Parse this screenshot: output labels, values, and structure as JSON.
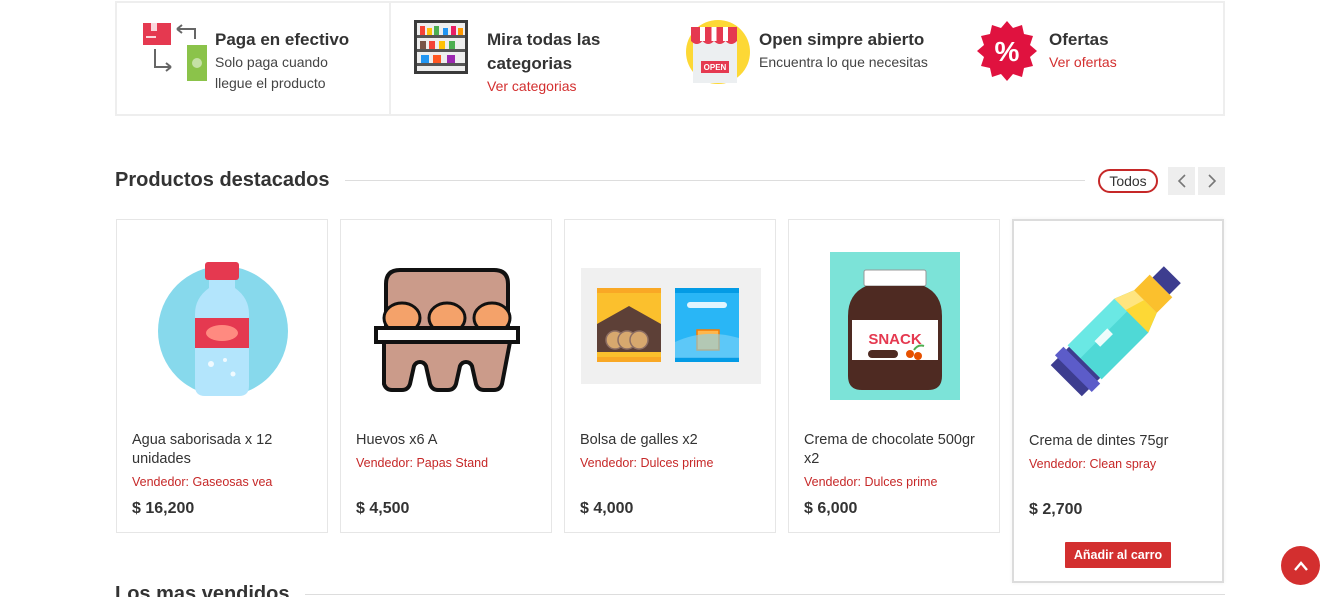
{
  "features": [
    {
      "title": "Paga en efectivo",
      "sub_lines": [
        "Solo paga cuando",
        "llegue el producto"
      ],
      "icon": "cash-exchange-icon"
    },
    {
      "title_lines": [
        "Mira todas las",
        "categorias"
      ],
      "link": "Ver categorias",
      "icon": "store-shelves-icon"
    },
    {
      "title": "Open simpre abierto",
      "sub": "Encuentra lo que necesitas",
      "icon": "open-store-icon"
    },
    {
      "title": "Ofertas",
      "link": "Ver ofertas",
      "icon": "discount-badge-icon"
    }
  ],
  "featured": {
    "title": "Productos destacados",
    "all_label": "Todos"
  },
  "products": [
    {
      "name": "Agua saborisada x 12 unidades",
      "vendor": "Vendedor: Gaseosas vea",
      "price": "$ 16,200",
      "icon": "water-bottle-icon"
    },
    {
      "name": "Huevos x6 A",
      "vendor": "Vendedor: Papas Stand",
      "price": "$ 4,500",
      "icon": "egg-carton-icon"
    },
    {
      "name": "Bolsa de galles x2",
      "vendor": "Vendedor: Dulces prime",
      "price": "$ 4,000",
      "icon": "cookie-bags-icon"
    },
    {
      "name": "Crema de chocolate 500gr x2",
      "vendor": "Vendedor: Dulces prime",
      "price": "$ 6,000",
      "icon": "snack-jar-icon"
    },
    {
      "name": "Crema de dintes 75gr",
      "vendor": "Vendedor: Clean spray",
      "price": "$ 2,700",
      "icon": "toothpaste-icon",
      "add_label": "Añadir al carro"
    }
  ],
  "snack_label": "SNACK",
  "open_label": "OPEN",
  "next_section": {
    "title": "Los mas vendidos"
  },
  "colors": {
    "accent": "#d32f2f",
    "border": "#eeeeee",
    "text": "#333333"
  }
}
